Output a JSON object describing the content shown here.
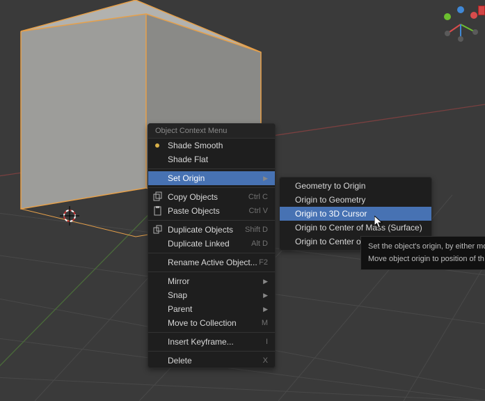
{
  "viewport": {
    "bg": "#3a3a3a",
    "grid_color": "#4a4a4a",
    "x_axis_color": "#8b3b3b",
    "y_axis_color": "#4a6b3a",
    "cube_fill": "#9a9a98",
    "cube_edge_highlight": "#e6a04a",
    "cube_edge_top": "#acacac",
    "cube_face_right": "#848482"
  },
  "gizmo": {
    "x_color": "#d94c4c",
    "y_color": "#6cbf2f",
    "z_color": "#4088d6",
    "neg_color": "#5a5a5a"
  },
  "context_menu": {
    "title": "Object Context Menu",
    "shade_smooth": "Shade Smooth",
    "shade_flat": "Shade Flat",
    "set_origin": "Set Origin",
    "copy_objects": "Copy Objects",
    "copy_objects_sc": "Ctrl C",
    "paste_objects": "Paste Objects",
    "paste_objects_sc": "Ctrl V",
    "duplicate_objects": "Duplicate Objects",
    "duplicate_objects_sc": "Shift D",
    "duplicate_linked": "Duplicate Linked",
    "duplicate_linked_sc": "Alt D",
    "rename_active": "Rename Active Object...",
    "rename_active_sc": "F2",
    "mirror": "Mirror",
    "snap": "Snap",
    "parent": "Parent",
    "move_to_collection": "Move to Collection",
    "move_to_collection_sc": "M",
    "insert_keyframe": "Insert Keyframe...",
    "insert_keyframe_sc": "I",
    "delete": "Delete",
    "delete_sc": "X"
  },
  "submenu": {
    "geometry_to_origin": "Geometry to Origin",
    "origin_to_geometry": "Origin to Geometry",
    "origin_to_3d_cursor": "Origin to 3D Cursor",
    "origin_com_surface": "Origin to Center of Mass (Surface)",
    "origin_com_volume": "Origin to Center of Mass (Volume)"
  },
  "tooltip": {
    "line1": "Set the object's origin, by either mo",
    "line2": "Move object origin to position of th"
  }
}
